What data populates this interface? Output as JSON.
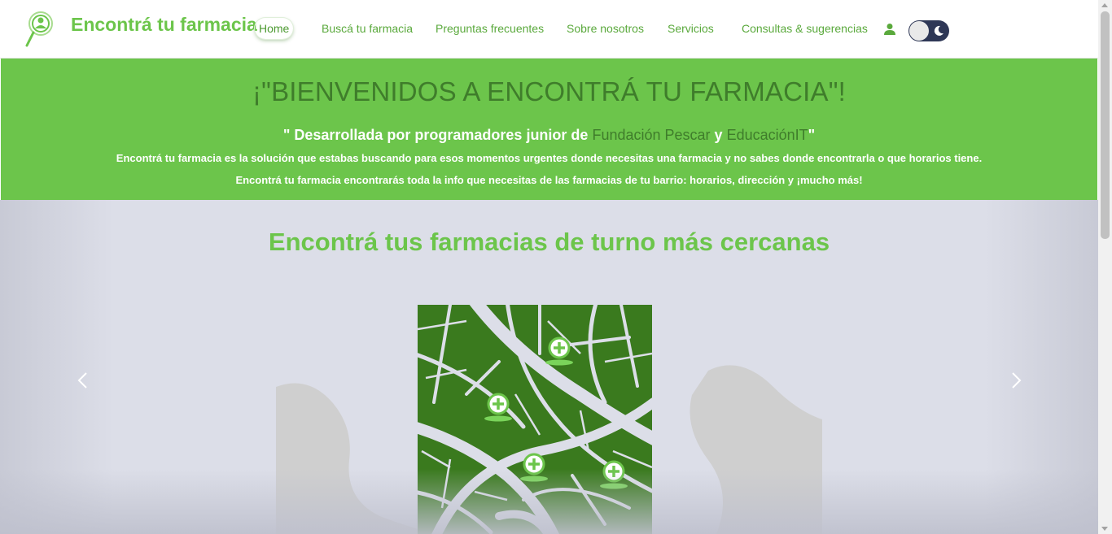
{
  "colors": {
    "brand_green": "#6cc54b",
    "dark_green": "#3f7d2b",
    "map_green": "#3a7a1e",
    "carousel_bg": "#dcdee8",
    "toggle_bg": "#2e3756"
  },
  "navbar": {
    "brand": "Encontrá tu farmacia",
    "logo_icon": "magnifier-pharmacy-icon",
    "items": [
      {
        "label": "Home",
        "active": true
      },
      {
        "label": "Buscá tu farmacia",
        "active": false
      },
      {
        "label": "Preguntas frecuentes",
        "active": false
      },
      {
        "label": "Sobre nosotros",
        "active": false
      },
      {
        "label": "Servicios",
        "active": false
      },
      {
        "label": "Consultas & sugerencias",
        "active": false
      }
    ],
    "user_icon": "user-icon",
    "theme_toggle": {
      "icon": "moon-icon",
      "dark_mode": false
    }
  },
  "hero": {
    "title": "¡\"BIENVENIDOS A ENCONTRÁ TU FARMACIA\"!",
    "subtitle_prefix": "\" Desarrollada por programadores junior de ",
    "subtitle_org1": "Fundación Pescar",
    "subtitle_and": " y ",
    "subtitle_org2": "EducaciónIT",
    "subtitle_suffix": "\"",
    "line1": "Encontrá tu farmacia es la solución que estabas buscando para esos momentos urgentes donde necesitas una farmacia y no sabes donde encontrarla o que horarios tiene.",
    "line2": "Encontrá tu farmacia encontrarás toda la info que necesitas de las farmacias de tu barrio: horarios, dirección y ¡mucho más!"
  },
  "carousel": {
    "slide_title": "Encontrá tus farmacias de turno más cercanas",
    "image_icon": "pharmacy-map-illustration",
    "prev_icon": "chevron-left-icon",
    "next_icon": "chevron-right-icon"
  }
}
